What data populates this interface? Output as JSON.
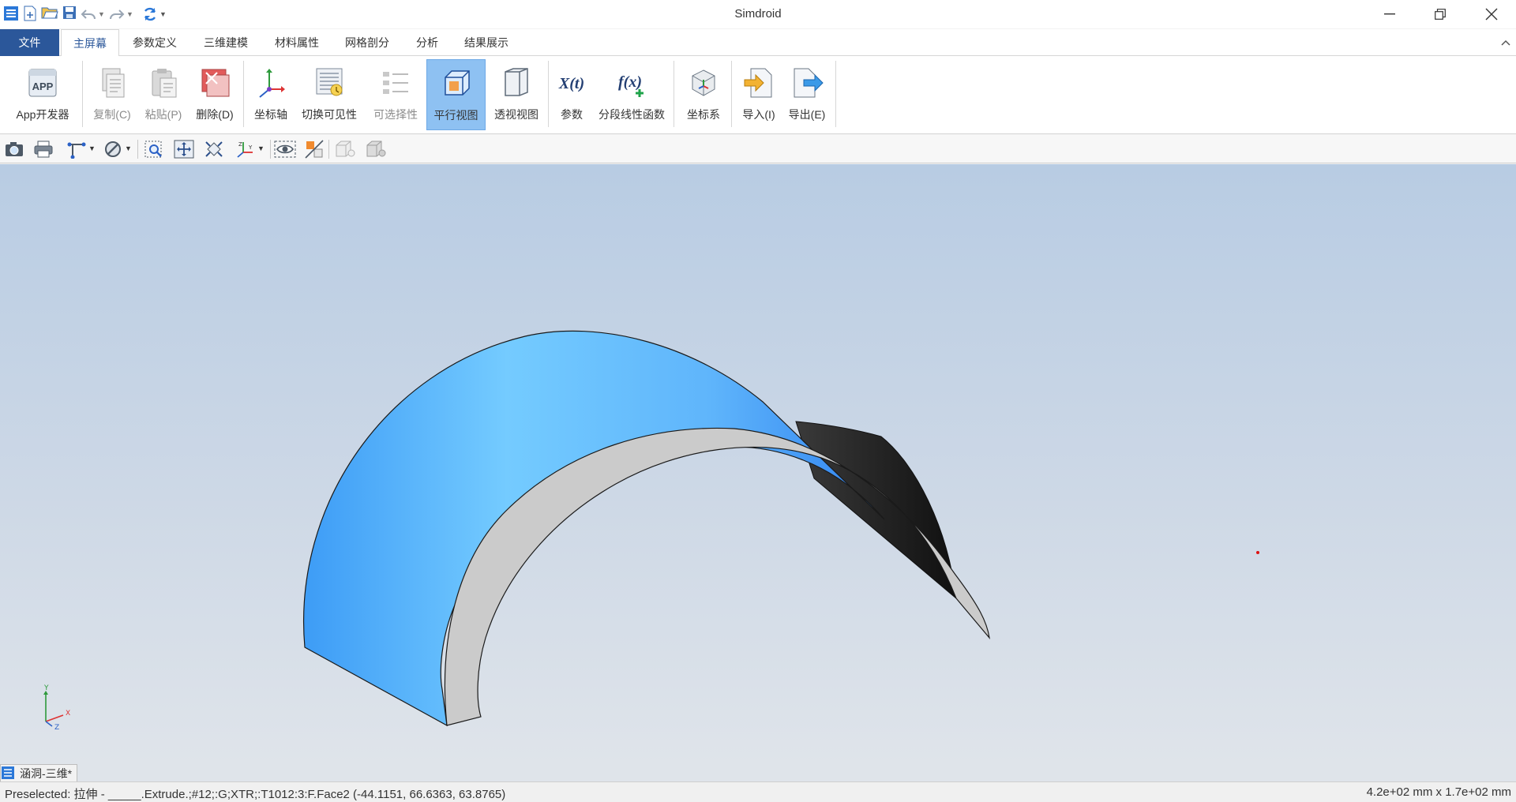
{
  "app": {
    "title": "Simdroid"
  },
  "tabs": {
    "file": "文件",
    "items": [
      "主屏幕",
      "参数定义",
      "三维建模",
      "材料属性",
      "网格剖分",
      "分析",
      "结果展示"
    ],
    "active": "主屏幕"
  },
  "ribbon": {
    "app_dev": "App开发器",
    "copy": "复制(C)",
    "paste": "粘贴(P)",
    "delete": "删除(D)",
    "axis": "坐标轴",
    "toggle_visibility": "切换可见性",
    "selectability": "可选择性",
    "parallel_view": "平行视图",
    "perspective_view": "透视视图",
    "params": "参数",
    "piecewise_func": "分段线性函数",
    "coord_system": "坐标系",
    "import": "导入(I)",
    "export": "导出(E)"
  },
  "icons": {
    "app_badge": "APP",
    "params_glyph": "X(t)",
    "func_glyph": "f(x)"
  },
  "viewport": {
    "triad_labels": {
      "x": "X",
      "y": "Y",
      "z": "Z"
    },
    "surface_color_light": "#74cbff",
    "surface_color_dark": "#3a95f5",
    "section_color": "#cbcbcb",
    "inner_color": "#1a1a1a"
  },
  "document": {
    "tab": "涵洞-三维*"
  },
  "status": {
    "preselected": "Preselected: 拉伸 - _____.Extrude.;#12;:G;XTR;:T1012:3:F.Face2 (-44.1151, 66.6363, 63.8765)",
    "dimensions": "4.2e+02 mm x 1.7e+02 mm"
  }
}
